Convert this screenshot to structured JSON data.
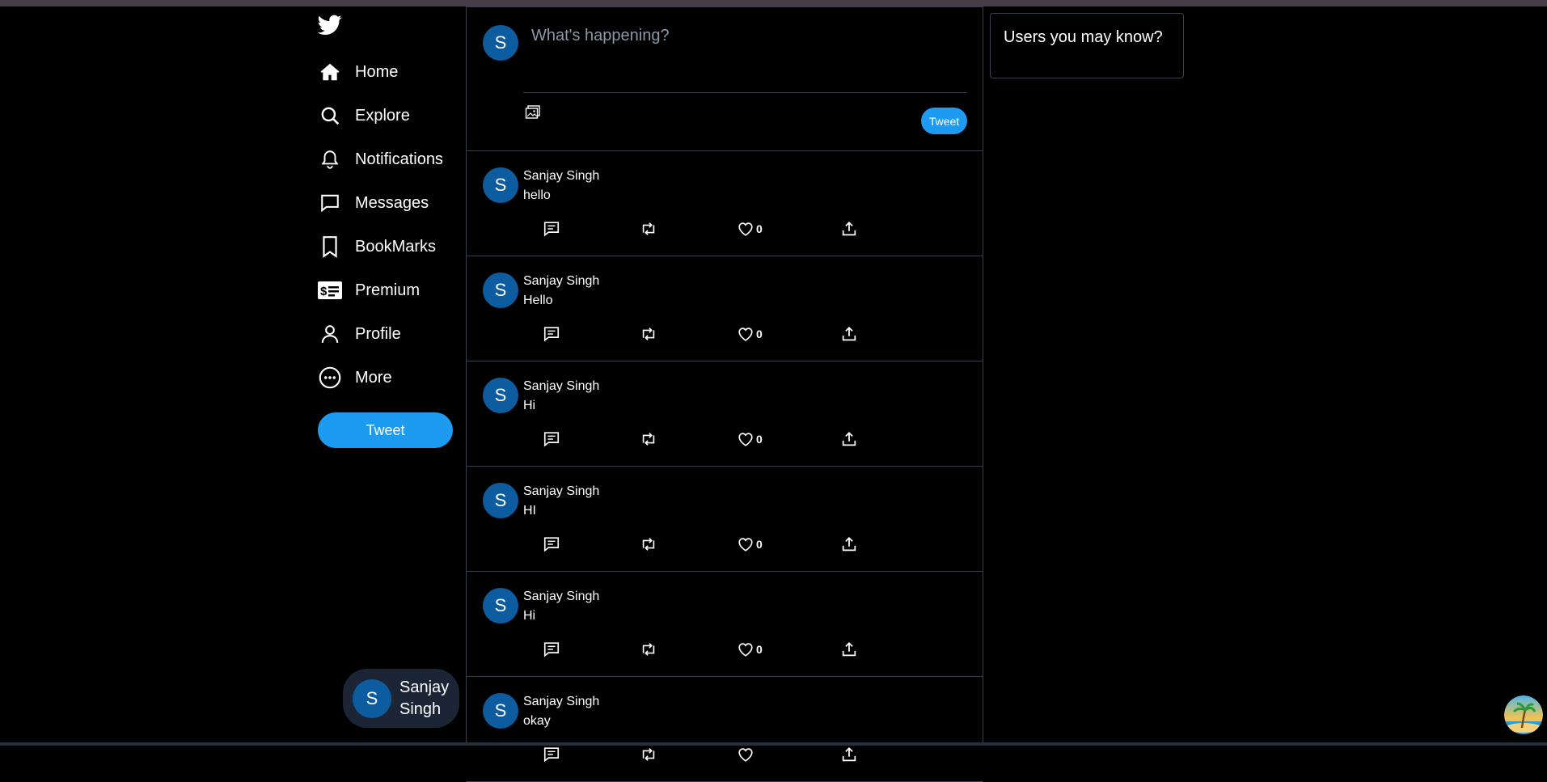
{
  "sidebar": {
    "items": [
      {
        "label": "Home",
        "icon": "home-icon"
      },
      {
        "label": "Explore",
        "icon": "search-icon"
      },
      {
        "label": "Notifications",
        "icon": "bell-icon"
      },
      {
        "label": "Messages",
        "icon": "message-icon"
      },
      {
        "label": "BookMarks",
        "icon": "bookmark-icon"
      },
      {
        "label": "Premium",
        "icon": "premium-card-icon"
      },
      {
        "label": "Profile",
        "icon": "profile-icon"
      },
      {
        "label": "More",
        "icon": "more-icon"
      }
    ],
    "tweet_label": "Tweet"
  },
  "user": {
    "initial": "S",
    "name": "Sanjay Singh"
  },
  "compose": {
    "placeholder": "What's happening?",
    "tweet_label": "Tweet"
  },
  "posts": [
    {
      "initial": "S",
      "author": "Sanjay Singh",
      "text": "hello",
      "likes": "0"
    },
    {
      "initial": "S",
      "author": "Sanjay Singh",
      "text": "Hello",
      "likes": "0"
    },
    {
      "initial": "S",
      "author": "Sanjay Singh",
      "text": "Hi",
      "likes": "0"
    },
    {
      "initial": "S",
      "author": "Sanjay Singh",
      "text": "HI",
      "likes": "0"
    },
    {
      "initial": "S",
      "author": "Sanjay Singh",
      "text": "Hi",
      "likes": "0"
    },
    {
      "initial": "S",
      "author": "Sanjay Singh",
      "text": "okay",
      "likes": ""
    }
  ],
  "suggestions": {
    "title": "Users you may know?"
  },
  "colors": {
    "accent": "#1d9bf0",
    "avatar": "#0d5ca0",
    "border": "#3a414a"
  }
}
